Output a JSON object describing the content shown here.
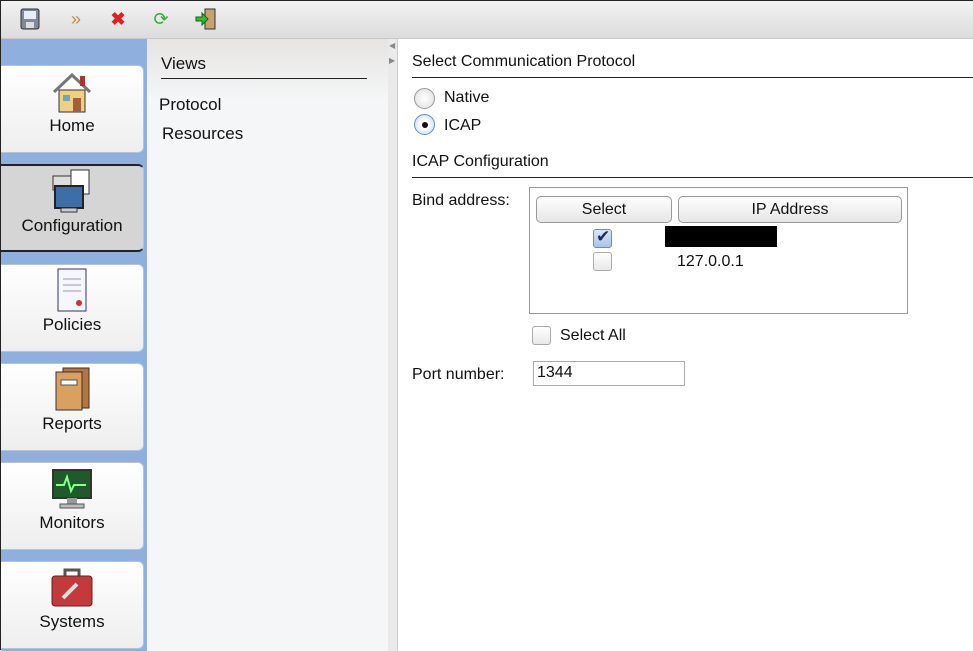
{
  "toolbar": {
    "icons": [
      "save-icon",
      "forward-icon",
      "delete-icon",
      "refresh-icon",
      "logout-icon"
    ]
  },
  "nav": {
    "items": [
      {
        "label": "Home",
        "icon": "home-icon"
      },
      {
        "label": "Configuration",
        "icon": "configuration-icon",
        "selected": true
      },
      {
        "label": "Policies",
        "icon": "policies-icon"
      },
      {
        "label": "Reports",
        "icon": "reports-icon"
      },
      {
        "label": "Monitors",
        "icon": "monitors-icon"
      },
      {
        "label": "Systems",
        "icon": "systems-icon"
      }
    ]
  },
  "views": {
    "title": "Views",
    "items": [
      "Protocol",
      "Resources"
    ]
  },
  "content": {
    "protocol_header": "Select Communication Protocol",
    "protocols": [
      {
        "label": "Native",
        "selected": false
      },
      {
        "label": "ICAP",
        "selected": true
      }
    ],
    "icap_header": "ICAP Configuration",
    "bind_label": "Bind address:",
    "table": {
      "headers": [
        "Select",
        "IP Address"
      ],
      "rows": [
        {
          "checked": true,
          "ip": "[redacted]"
        },
        {
          "checked": false,
          "ip": "127.0.0.1"
        }
      ]
    },
    "select_all": "Select All",
    "port_label": "Port number:",
    "port_value": "1344"
  }
}
